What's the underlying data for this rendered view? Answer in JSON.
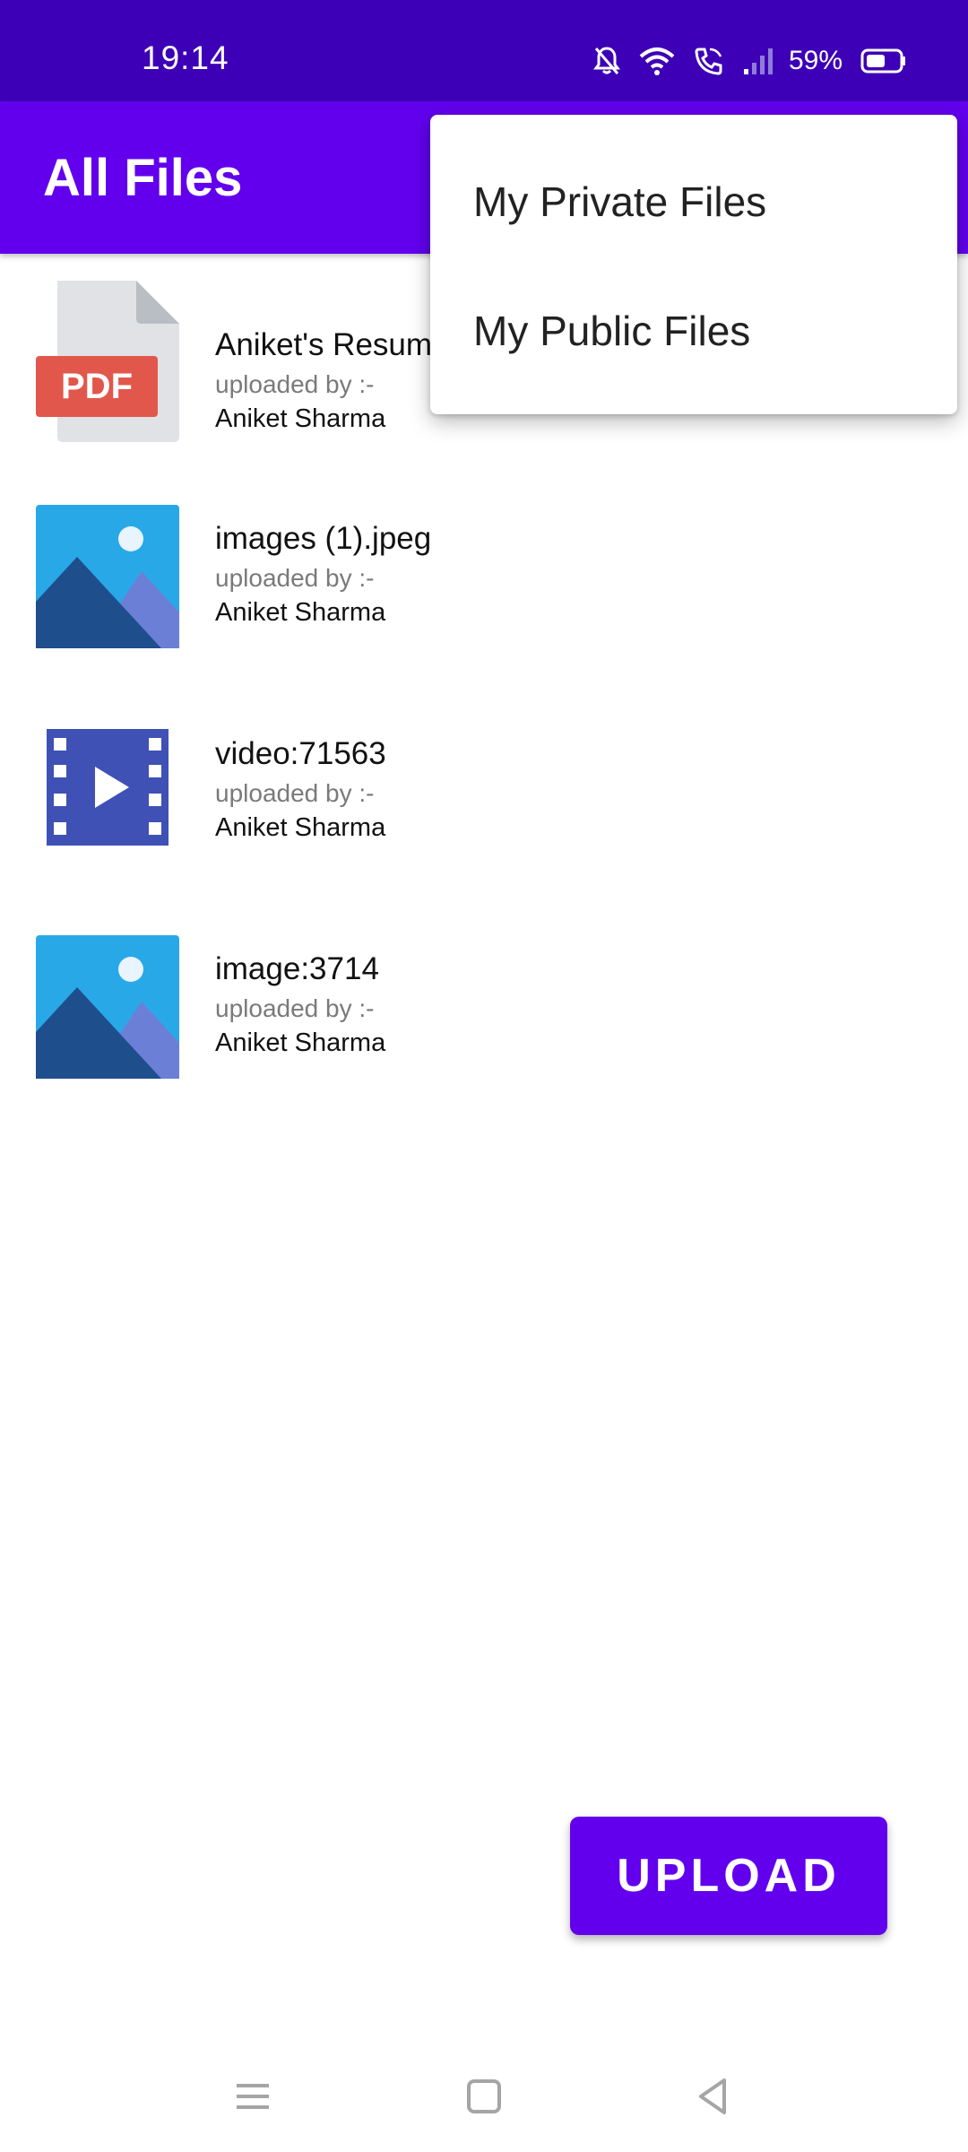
{
  "status_bar": {
    "time": "19:14",
    "battery_percent": "59%",
    "icons": [
      "bell-off-icon",
      "wifi-icon",
      "wifi-call-icon",
      "signal-icon",
      "battery-icon"
    ]
  },
  "app_bar": {
    "title": "All Files",
    "background": "#6200EE"
  },
  "overflow_menu": {
    "items": [
      {
        "label": "My Private Files"
      },
      {
        "label": "My Public Files"
      }
    ]
  },
  "files": [
    {
      "name": "Aniket's Resume",
      "uploaded_by_label": "uploaded by :-",
      "author": "Aniket Sharma",
      "icon": "pdf-icon"
    },
    {
      "name": "images (1).jpeg",
      "uploaded_by_label": "uploaded by :-",
      "author": "Aniket Sharma",
      "icon": "image-icon"
    },
    {
      "name": "video:71563",
      "uploaded_by_label": "uploaded by :-",
      "author": "Aniket Sharma",
      "icon": "video-icon"
    },
    {
      "name": "image:3714",
      "uploaded_by_label": "uploaded by :-",
      "author": "Aniket Sharma",
      "icon": "image-icon"
    }
  ],
  "pdf_badge_text": "PDF",
  "upload_button": {
    "label": "UPLOAD"
  },
  "nav_bar": {
    "icons": [
      "menu-icon",
      "home-icon",
      "back-icon"
    ]
  }
}
